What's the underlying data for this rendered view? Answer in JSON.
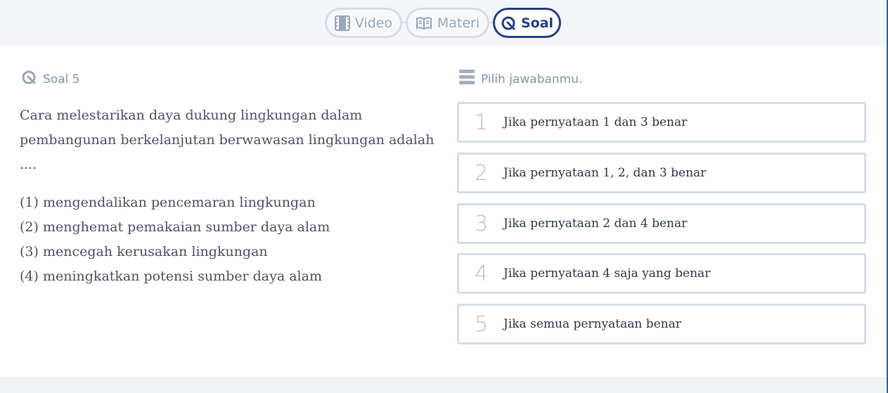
{
  "tabs": [
    {
      "label": "Video",
      "icon": "film-icon"
    },
    {
      "label": "Materi",
      "icon": "book-icon"
    },
    {
      "label": "Soal",
      "icon": "quiz-icon",
      "active": true
    }
  ],
  "question": {
    "header": "Soal 5",
    "text": "Cara melestarikan daya dukung lingkungan dalam pembangunan berkelanjutan berwawasan lingkungan adalah ....",
    "statements": [
      "(1) mengendalikan pencemaran lingkungan",
      "(2) menghemat pemakaian sumber daya alam",
      "(3) mencegah kerusakan lingkungan",
      "(4) meningkatkan potensi sumber daya alam"
    ]
  },
  "answers": {
    "header": "Pilih jawabanmu.",
    "options": [
      {
        "number": "1",
        "text": "Jika pernyataan 1 dan 3 benar"
      },
      {
        "number": "2",
        "text": "Jika pernyataan 1, 2, dan 3 benar"
      },
      {
        "number": "3",
        "text": "Jika pernyataan 2 dan 4 benar"
      },
      {
        "number": "4",
        "text": "Jika pernyataan 4 saja yang benar"
      },
      {
        "number": "5",
        "text": "Jika semua pernyataan benar"
      }
    ]
  },
  "colors": {
    "accent": "#23408e",
    "muted": "#8796ab",
    "border": "#d4dde8"
  }
}
